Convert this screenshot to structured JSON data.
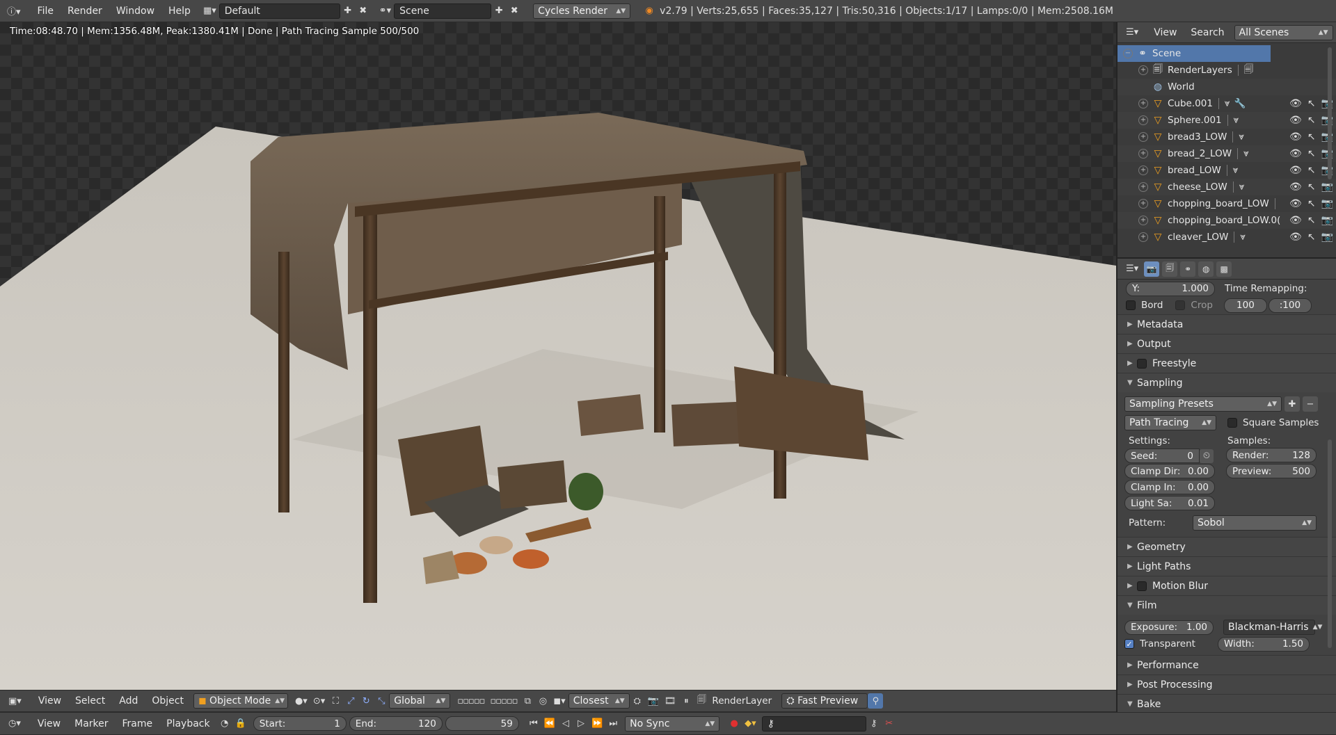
{
  "topbar": {
    "menus": [
      "File",
      "Render",
      "Window",
      "Help"
    ],
    "layout": "Default",
    "scene": "Scene",
    "engine": "Cycles Render",
    "stats": "v2.79 | Verts:25,655 | Faces:35,127 | Tris:50,316 | Objects:1/17 | Lamps:0/0 | Mem:2508.16M"
  },
  "viewport": {
    "render_info": "Time:08:48.70 | Mem:1356.48M, Peak:1380.41M | Done | Path Tracing Sample 500/500"
  },
  "viewport_header": {
    "menus": [
      "View",
      "Select",
      "Add",
      "Object"
    ],
    "mode": "Object Mode",
    "orientation": "Global",
    "snap": "Closest",
    "render_layer": "RenderLayer",
    "fast_preview": "Fast Preview"
  },
  "timeline": {
    "menus": [
      "View",
      "Marker",
      "Frame",
      "Playback"
    ],
    "start_label": "Start:",
    "start": "1",
    "end_label": "End:",
    "end": "120",
    "current": "59",
    "sync": "No Sync"
  },
  "outliner": {
    "view": "View",
    "search": "Search",
    "filter": "All Scenes",
    "items": [
      {
        "name": "Scene",
        "type": "scene"
      },
      {
        "name": "RenderLayers",
        "type": "renderlayers"
      },
      {
        "name": "World",
        "type": "world"
      },
      {
        "name": "Cube.001",
        "type": "mesh"
      },
      {
        "name": "Sphere.001",
        "type": "mesh"
      },
      {
        "name": "bread3_LOW",
        "type": "mesh"
      },
      {
        "name": "bread_2_LOW",
        "type": "mesh"
      },
      {
        "name": "bread_LOW",
        "type": "mesh"
      },
      {
        "name": "cheese_LOW",
        "type": "mesh"
      },
      {
        "name": "chopping_board_LOW",
        "type": "mesh"
      },
      {
        "name": "chopping_board_LOW.0(",
        "type": "mesh"
      },
      {
        "name": "cleaver_LOW",
        "type": "mesh"
      }
    ]
  },
  "properties": {
    "y_label": "Y:",
    "y_value": "1.000",
    "time_remapping": "Time Remapping:",
    "remap_old": "100",
    "remap_new": ":100",
    "bord": "Bord",
    "crop": "Crop",
    "sections_top": [
      "Metadata",
      "Output",
      "Freestyle"
    ],
    "sampling": "Sampling",
    "sampling_presets": "Sampling Presets",
    "integrator": "Path Tracing",
    "square_samples": "Square Samples",
    "settings_label": "Settings:",
    "samples_label": "Samples:",
    "seed_label": "Seed:",
    "seed": "0",
    "clamp_dir_label": "Clamp Dir:",
    "clamp_dir": "0.00",
    "clamp_in_label": "Clamp In:",
    "clamp_in": "0.00",
    "light_sa_label": "Light Sa:",
    "light_sa": "0.01",
    "render_label": "Render:",
    "render": "128",
    "preview_label": "Preview:",
    "preview": "500",
    "pattern_label": "Pattern:",
    "pattern": "Sobol",
    "sections_mid": [
      "Geometry",
      "Light Paths",
      "Motion Blur"
    ],
    "film": "Film",
    "exposure_label": "Exposure:",
    "exposure": "1.00",
    "filter_type": "Blackman-Harris",
    "transparent": "Transparent",
    "width_label": "Width:",
    "width": "1.50",
    "sections_bottom": [
      "Performance",
      "Post Processing",
      "Bake"
    ]
  },
  "colors": {
    "accent": "#5277aa",
    "mesh_icon": "#f0a020",
    "panel": "#424242",
    "header": "#474747"
  }
}
